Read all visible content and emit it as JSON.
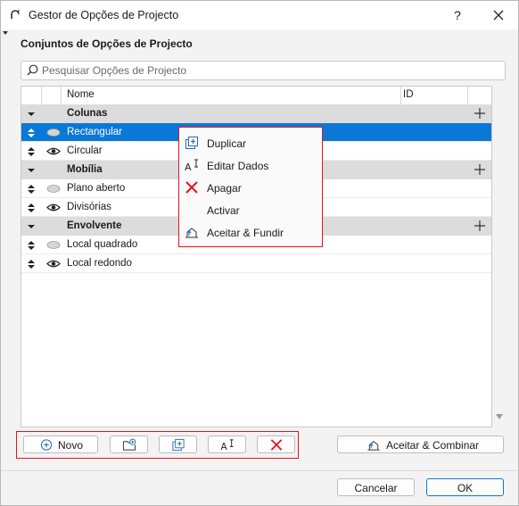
{
  "window": {
    "title": "Gestor de Opções de Projecto",
    "help_label": "?"
  },
  "panel": {
    "section_title": "Conjuntos de Opções de Projecto",
    "search_placeholder": "Pesquisar Opções de Projecto"
  },
  "table": {
    "columns": [
      "Nome",
      "ID"
    ],
    "rows": [
      {
        "kind": "group",
        "label": "Colunas"
      },
      {
        "kind": "item",
        "label": "Rectangular",
        "visibility": "hidden",
        "selected": true
      },
      {
        "kind": "item",
        "label": "Circular",
        "visibility": "visible",
        "selected": false
      },
      {
        "kind": "group",
        "label": "Mobília"
      },
      {
        "kind": "item",
        "label": "Plano aberto",
        "visibility": "hidden",
        "selected": false
      },
      {
        "kind": "item",
        "label": "Divisórias",
        "visibility": "visible",
        "selected": false
      },
      {
        "kind": "group",
        "label": "Envolvente"
      },
      {
        "kind": "item",
        "label": "Local quadrado",
        "visibility": "hidden",
        "selected": false
      },
      {
        "kind": "item",
        "label": "Local redondo",
        "visibility": "visible",
        "selected": false
      }
    ]
  },
  "context_menu": {
    "items": [
      {
        "label": "Duplicar",
        "icon": "duplicate-icon"
      },
      {
        "label": "Editar Dados",
        "icon": "edit-data-icon"
      },
      {
        "label": "Apagar",
        "icon": "delete-icon"
      },
      {
        "label": "Activar",
        "icon": ""
      },
      {
        "label": "Aceitar & Fundir",
        "icon": "accept-merge-icon"
      }
    ]
  },
  "toolbar": {
    "new_label": "Novo",
    "accept_combine_label": "Aceitar & Combinar"
  },
  "footer": {
    "cancel_label": "Cancelar",
    "ok_label": "OK"
  },
  "colors": {
    "selection": "#0a78d7",
    "highlight_border": "#e81123",
    "group_row": "#dcdcdc"
  }
}
